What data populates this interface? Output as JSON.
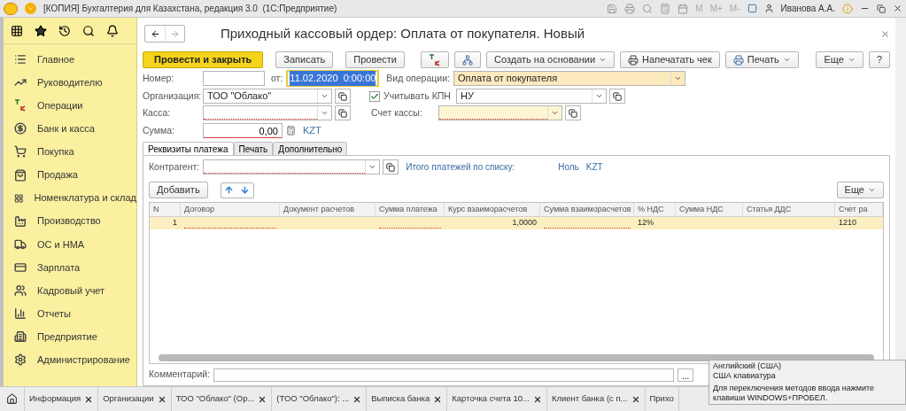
{
  "window": {
    "title": "[КОПИЯ] Бухгалтерия для Казахстана, редакция 3.0  (1С:Предприятие)",
    "memory_buttons": [
      "M",
      "M+",
      "M-"
    ],
    "user": "Иванова А.А."
  },
  "sidebar": {
    "items": [
      {
        "label": "Главное"
      },
      {
        "label": "Руководителю"
      },
      {
        "label": "Операции"
      },
      {
        "label": "Банк и касса"
      },
      {
        "label": "Покупка"
      },
      {
        "label": "Продажа"
      },
      {
        "label": "Номенклатура и склад"
      },
      {
        "label": "Производство"
      },
      {
        "label": "ОС и НМА"
      },
      {
        "label": "Зарплата"
      },
      {
        "label": "Кадровый учет"
      },
      {
        "label": "Отчеты"
      },
      {
        "label": "Предприятие"
      },
      {
        "label": "Администрирование"
      }
    ]
  },
  "form": {
    "title": "Приходный кассовый ордер: Оплата от покупателя. Новый",
    "toolbar": [
      {
        "label": "Провести и закрыть",
        "kind": "primary"
      },
      {
        "label": "Записать",
        "kind": "plain"
      },
      {
        "label": "Провести",
        "kind": "plain"
      },
      {
        "kind": "dtkt"
      },
      {
        "kind": "structure"
      },
      {
        "label": "Создать на основании",
        "kind": "dropdown"
      },
      {
        "label": "Напечатать чек",
        "kind": "printer"
      },
      {
        "label": "Печать",
        "kind": "print-dropdown"
      }
    ],
    "more_button": "Еще",
    "help_button": "?",
    "number_label": "Номер:",
    "date_label": "от:",
    "date_value": "11.02.2020  0:00:00",
    "operation_label": "Вид операции:",
    "operation_value": "Оплата от покупателя",
    "organization_label": "Организация:",
    "organization_value": "ТОО \"Облако\"",
    "kpn": {
      "label": "Учитывать КПН",
      "checked": true,
      "value": "НУ"
    },
    "cash_label": "Касса:",
    "cash_account_label": "Счет кассы:",
    "sum_label": "Сумма:",
    "sum_value": "0,00",
    "currency": "KZT",
    "tabs": [
      {
        "label": "Реквизиты платежа",
        "selected": true
      },
      {
        "label": "Печать",
        "selected": false
      },
      {
        "label": "Дополнительно",
        "selected": false
      }
    ],
    "counterparty_label": "Контрагент:",
    "total_label": "Итого платежей по списку:",
    "total_value": "Ноль",
    "total_currency": "KZT",
    "add_button": "Добавить",
    "table_more_button": "Еще",
    "table": {
      "columns": [
        "N",
        "Договор",
        "Документ расчетов",
        "Сумма платежа",
        "Курс взаиморасчетов",
        "Сумма взаиморасчетов",
        "% НДС",
        "Сумма НДС",
        "Статья ДДС",
        "Счет ра"
      ],
      "rows": [
        {
          "selected": true,
          "cells": [
            {
              "value": "1"
            },
            {
              "required": true
            },
            {
              "required": false
            },
            {
              "required": true
            },
            {
              "value": "1,0000"
            },
            {
              "required": true
            },
            {
              "value": "12%"
            },
            {
              "required": false
            },
            {
              "required": false
            },
            {
              "value": "1210"
            }
          ]
        }
      ]
    },
    "comment_label": "Комментарий:",
    "comment_button": "..."
  },
  "open_tabs": [
    {
      "label": "Информация"
    },
    {
      "label": "Организации"
    },
    {
      "label": "ТОО \"Облако\" (Ор..."
    },
    {
      "label": "(ТОО \"Облако\"): ..."
    },
    {
      "label": "Выписка банка"
    },
    {
      "label": "Карточка счета 10..."
    },
    {
      "label": "Клиент банка (с п..."
    },
    {
      "label": "Прихо"
    }
  ],
  "tooltip": {
    "lines": [
      "Английский (США)",
      "США клавиатура",
      "Для переключения методов ввода нажмите клавиши WINDOWS+ПРОБЕЛ."
    ]
  }
}
